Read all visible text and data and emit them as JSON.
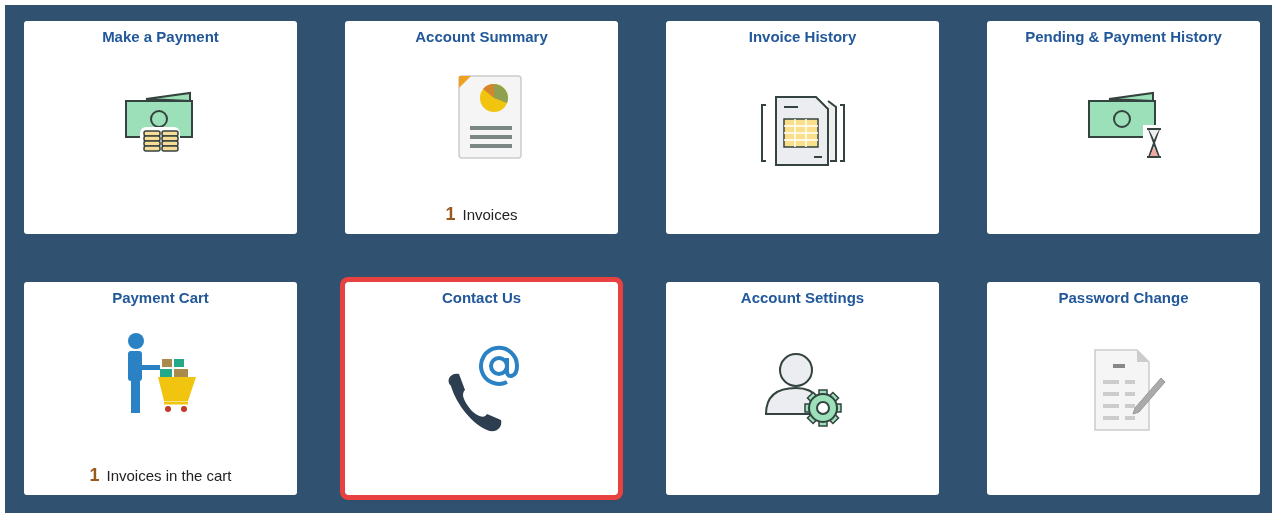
{
  "tiles": [
    {
      "title": "Make a Payment",
      "kind": "payment",
      "highlighted": false
    },
    {
      "title": "Account Summary",
      "kind": "summary",
      "highlighted": false,
      "count": "1",
      "count_label": "Invoices"
    },
    {
      "title": "Invoice History",
      "kind": "invoice_history",
      "highlighted": false
    },
    {
      "title": "Pending & Payment History",
      "kind": "pending",
      "highlighted": false
    },
    {
      "title": "Payment Cart",
      "kind": "cart",
      "highlighted": false,
      "count": "1",
      "count_label": "Invoices in the cart"
    },
    {
      "title": "Contact Us",
      "kind": "contact",
      "highlighted": true
    },
    {
      "title": "Account Settings",
      "kind": "settings",
      "highlighted": false
    },
    {
      "title": "Password Change",
      "kind": "password",
      "highlighted": false
    }
  ]
}
